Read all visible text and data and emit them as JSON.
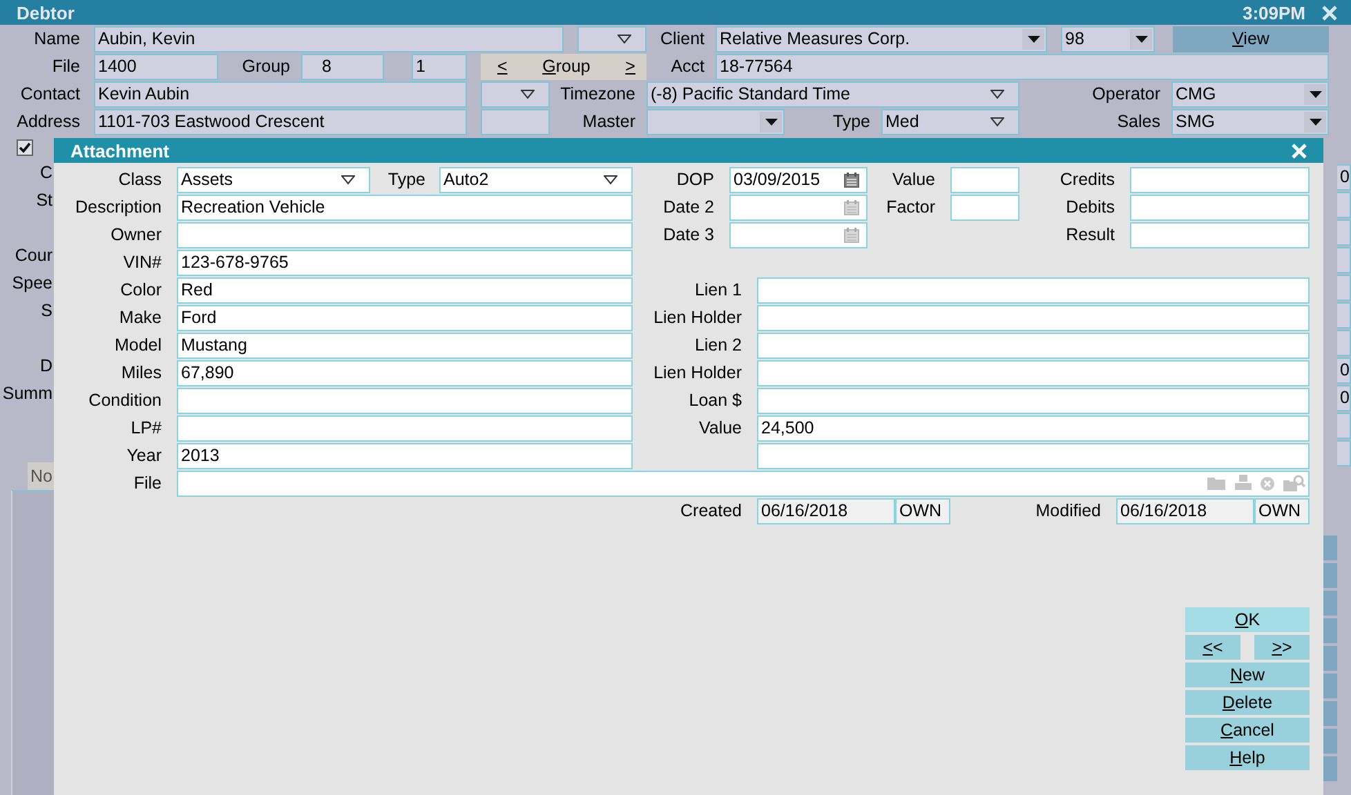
{
  "debtor": {
    "title": "Debtor",
    "time": "3:09PM",
    "name": {
      "label": "Name",
      "value": "Aubin, Kevin"
    },
    "client": {
      "label": "Client",
      "value": "Relative Measures Corp."
    },
    "client_code": {
      "value": "98"
    },
    "view_button": "View",
    "file": {
      "label": "File",
      "value": "1400"
    },
    "group": {
      "label": "Group",
      "value": "8"
    },
    "group_index": {
      "value": "1"
    },
    "group_nav": {
      "prev": "<",
      "label": "Group",
      "next": ">"
    },
    "acct": {
      "label": "Acct",
      "value": "18-77564"
    },
    "contact": {
      "label": "Contact",
      "value": "Kevin Aubin"
    },
    "timezone": {
      "label": "Timezone",
      "value": "(-8) Pacific Standard Time"
    },
    "operator": {
      "label": "Operator",
      "value": "CMG"
    },
    "address": {
      "label": "Address",
      "value": "1101-703 Eastwood Crescent"
    },
    "master": {
      "label": "Master"
    },
    "type": {
      "label": "Type",
      "value": "Med"
    },
    "sales": {
      "label": "Sales",
      "value": "SMG"
    },
    "flag_checked": true,
    "side_labels": [
      "C",
      "St",
      "Cour",
      "Spee",
      "S",
      "D",
      "Summ"
    ],
    "tab": "No",
    "edge_values": [
      "0",
      "0",
      "0"
    ]
  },
  "attachment": {
    "title": "Attachment",
    "class": {
      "label": "Class",
      "value": "Assets"
    },
    "type": {
      "label": "Type",
      "value": "Auto2"
    },
    "fields": [
      {
        "label": "Description",
        "value": "Recreation Vehicle"
      },
      {
        "label": "Owner"
      },
      {
        "label": "VIN#",
        "value": "123-678-9765"
      },
      {
        "label": "Color",
        "value": "Red"
      },
      {
        "label": "Make",
        "value": "Ford"
      },
      {
        "label": "Model",
        "value": "Mustang"
      },
      {
        "label": "Miles",
        "value": "67,890"
      },
      {
        "label": "Condition"
      },
      {
        "label": "LP#"
      },
      {
        "label": "Year",
        "value": "2013"
      }
    ],
    "dates": [
      {
        "label": "DOP",
        "value": "03/09/2015"
      },
      {
        "label": "Date 2"
      },
      {
        "label": "Date 3"
      }
    ],
    "amounts": [
      {
        "label": "Value"
      },
      {
        "label": "Factor"
      }
    ],
    "totals": [
      {
        "label": "Credits"
      },
      {
        "label": "Debits"
      },
      {
        "label": "Result"
      }
    ],
    "liens": [
      {
        "label": "Lien 1"
      },
      {
        "label": "Lien Holder"
      },
      {
        "label": "Lien 2"
      },
      {
        "label": "Lien Holder"
      },
      {
        "label": "Loan $"
      },
      {
        "label": "Value",
        "value": "24,500"
      }
    ],
    "file": {
      "label": "File"
    },
    "created": {
      "label": "Created",
      "date": "06/16/2018",
      "by": "OWN"
    },
    "modified": {
      "label": "Modified",
      "date": "06/16/2018",
      "by": "OWN"
    },
    "buttons": [
      {
        "label": "OK",
        "kind": "default"
      },
      {
        "label": "<<",
        "kind": "nav"
      },
      {
        "label": ">>",
        "kind": "nav"
      },
      {
        "label": "New",
        "kind": "action"
      },
      {
        "label": "Delete",
        "kind": "action"
      },
      {
        "label": "Cancel",
        "kind": "action"
      },
      {
        "label": "Help",
        "kind": "action"
      }
    ]
  }
}
